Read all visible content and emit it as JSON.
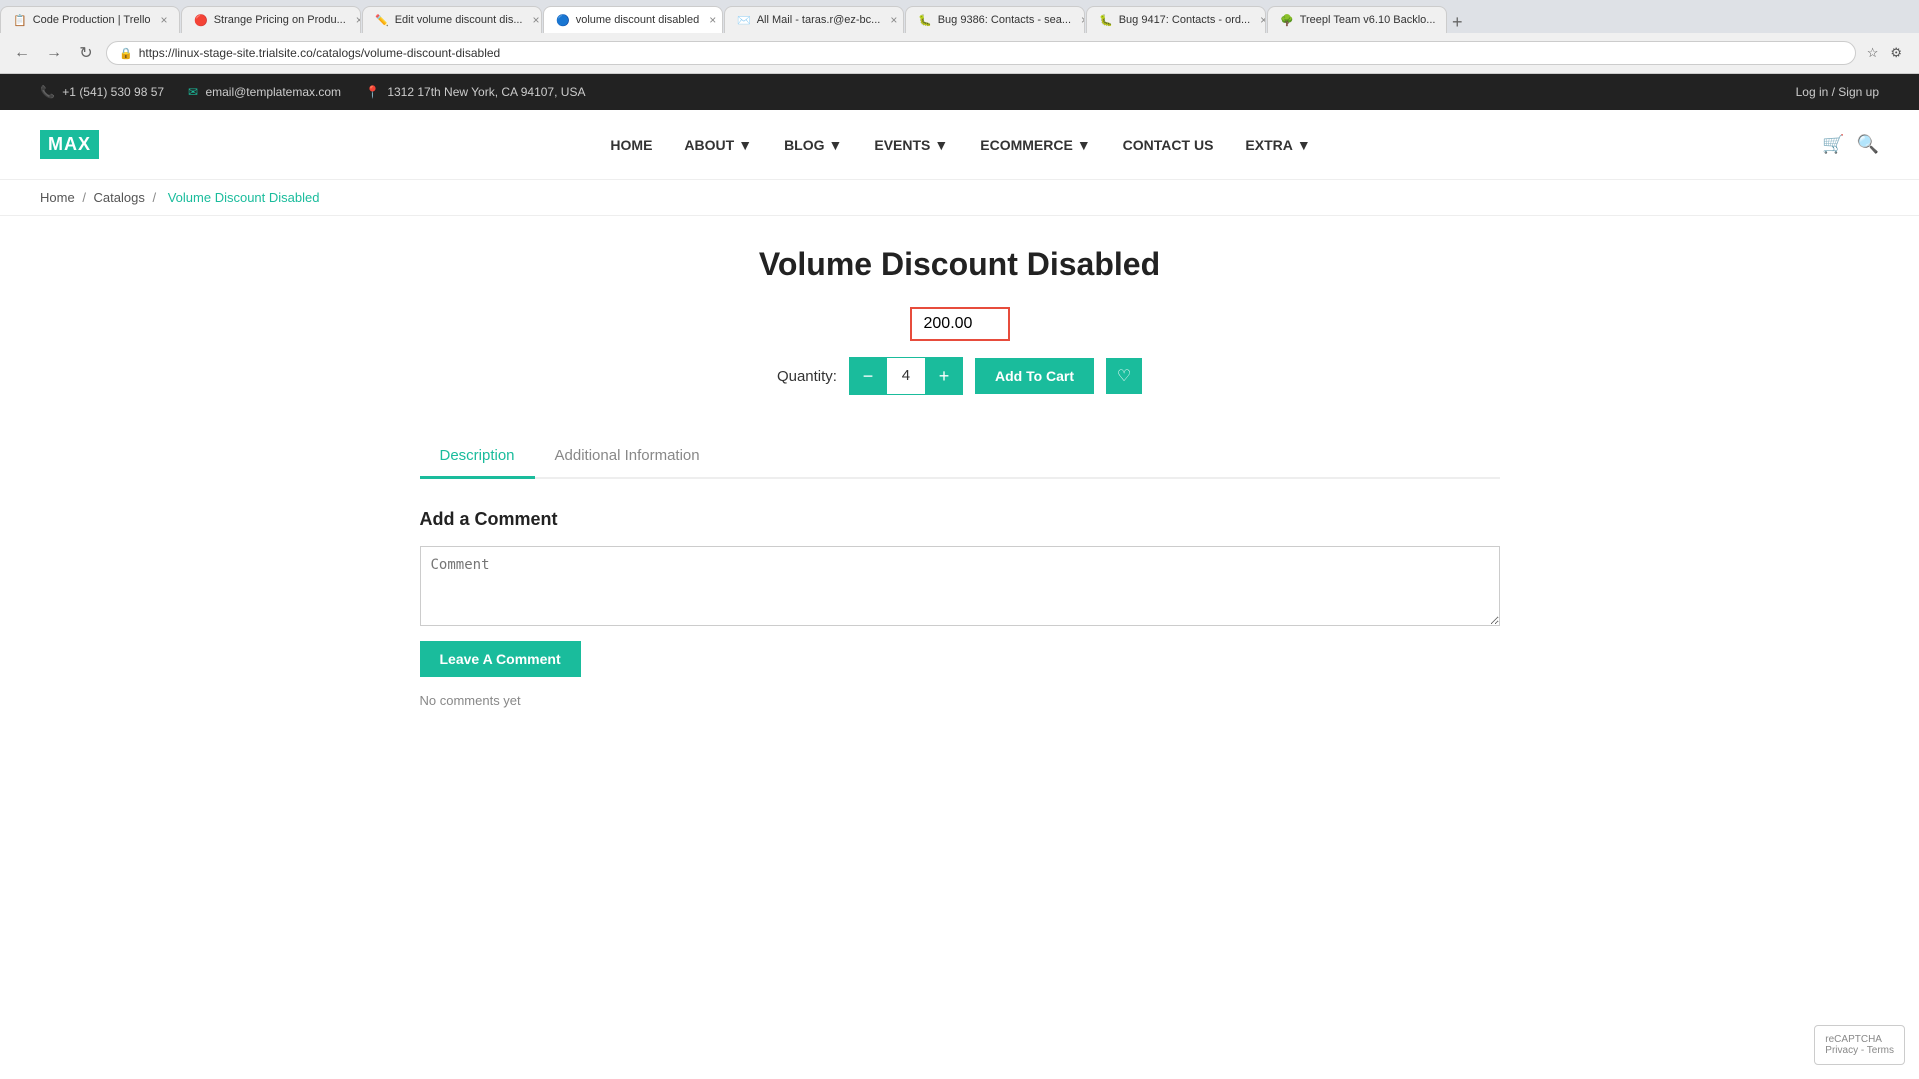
{
  "browser": {
    "tabs": [
      {
        "id": "tab1",
        "title": "Code Production | Trello",
        "favicon": "📋",
        "active": false
      },
      {
        "id": "tab2",
        "title": "Strange Pricing on Produ...",
        "favicon": "🔴",
        "active": false
      },
      {
        "id": "tab3",
        "title": "Edit volume discount dis...",
        "favicon": "✏️",
        "active": false
      },
      {
        "id": "tab4",
        "title": "volume discount disabled",
        "favicon": "🔵",
        "active": true
      },
      {
        "id": "tab5",
        "title": "All Mail - taras.r@ez-bc...",
        "favicon": "✉️",
        "active": false
      },
      {
        "id": "tab6",
        "title": "Bug 9386: Contacts - sea...",
        "favicon": "🐛",
        "active": false
      },
      {
        "id": "tab7",
        "title": "Bug 9417: Contacts - ord...",
        "favicon": "🐛",
        "active": false
      },
      {
        "id": "tab8",
        "title": "Treepl Team v6.10 Backlo...",
        "favicon": "🌳",
        "active": false
      }
    ],
    "url": "https://linux-stage-site.trialsite.co/catalogs/volume-discount-disabled"
  },
  "topbar": {
    "phone": "+1 (541) 530 98 57",
    "email": "email@templatemax.com",
    "address": "1312 17th New York, CA 94107, USA",
    "login": "Log in / Sign up"
  },
  "nav": {
    "logo_text": "MAX",
    "items": [
      {
        "label": "HOME",
        "has_dropdown": false
      },
      {
        "label": "ABOUT",
        "has_dropdown": true
      },
      {
        "label": "BLOG",
        "has_dropdown": true
      },
      {
        "label": "EVENTS",
        "has_dropdown": true
      },
      {
        "label": "ECOMMERCE",
        "has_dropdown": true
      },
      {
        "label": "CONTACT US",
        "has_dropdown": false
      },
      {
        "label": "EXTRA",
        "has_dropdown": true
      }
    ]
  },
  "breadcrumb": {
    "items": [
      "Home",
      "Catalogs",
      "Volume Discount Disabled"
    ],
    "separators": [
      "/",
      "/"
    ]
  },
  "product": {
    "title": "Volume Discount Disabled",
    "price": "200.00",
    "quantity": "4",
    "quantity_label": "Quantity:",
    "add_to_cart": "Add To Cart"
  },
  "tabs": {
    "items": [
      {
        "label": "Description",
        "active": true
      },
      {
        "label": "Additional Information",
        "active": false
      }
    ]
  },
  "comment_section": {
    "title": "Add a Comment",
    "placeholder": "Comment",
    "button_label": "Leave A Comment",
    "no_comments": "No comments yet"
  },
  "recaptcha": {
    "line1": "reCAPTCHA",
    "line2": "Privacy - Terms"
  }
}
